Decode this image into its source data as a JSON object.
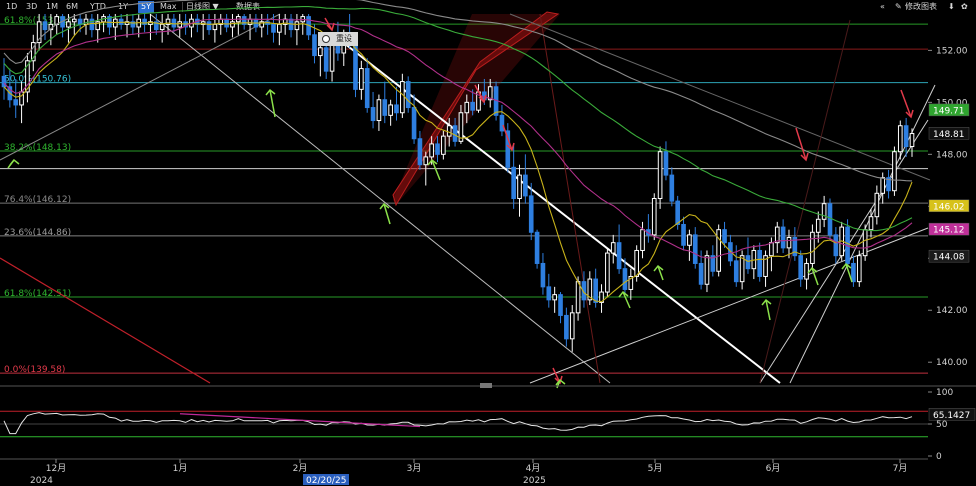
{
  "toolbar": {
    "ranges": [
      "1D",
      "3D",
      "1M",
      "6M",
      "YTD",
      "1Y",
      "5Y",
      "Max"
    ],
    "active_range": "5Y",
    "chart_type_label": "日线图 ▼",
    "table_label": "数据表",
    "edit_chart_label": "修改图表",
    "reset_label": "重设"
  },
  "colors": {
    "candle_up": "#ffffff",
    "candle_down": "#2e7fe0",
    "ma_yellow": "#c8b21a",
    "ma_green": "#3aaa3a",
    "ma_magenta": "#b0308a",
    "ma_gray": "#8a8a8a",
    "trend_white": "#ffffff",
    "fib_green": "#2fb52f",
    "fib_cyan": "#35c1d6",
    "red_arrow": "#e23a4a",
    "green_arrow": "#8be04a",
    "rsi_line": "#e6e6e6",
    "rsi_mag": "#c02a9a"
  },
  "chart_data": {
    "type": "candlestick",
    "y_range": [
      139.2,
      153.4
    ],
    "y_ticks": [
      140,
      142,
      144,
      146,
      148,
      150,
      152
    ],
    "y_tick_labels": [
      "140.00",
      "142.00",
      "144.00",
      "146.00",
      "148.00",
      "150.00",
      "152.00"
    ],
    "fib_levels": [
      {
        "label": "61.8%(153.01)",
        "value": 153.01
      },
      {
        "label": "50.0%(150.76)",
        "value": 150.76
      },
      {
        "label": "38.2%(148.13)",
        "value": 148.13
      },
      {
        "label": "76.4%(146.12)",
        "value": 146.12
      },
      {
        "label": "23.6%(144.86)",
        "value": 144.86
      },
      {
        "label": "61.8%(142.51)",
        "value": 142.51
      },
      {
        "label": "0.0%(139.58)",
        "value": 139.58
      }
    ],
    "price_labels": [
      {
        "text": "149.71",
        "value": 149.71,
        "bg": "#2fa52f"
      },
      {
        "text": "148.81",
        "value": 148.81,
        "bg": "#101010"
      },
      {
        "text": "146.02",
        "value": 146.02,
        "bg": "#d7c21a"
      },
      {
        "text": "145.12",
        "value": 145.12,
        "bg": "#c0309a"
      },
      {
        "text": "144.08",
        "value": 144.08,
        "bg": "#1a1a1a"
      }
    ],
    "x_labels": [
      {
        "text": "12月",
        "sub": "2024"
      },
      {
        "text": "1月",
        "sub": ""
      },
      {
        "text": "2月",
        "sub": ""
      },
      {
        "text": "3月",
        "sub": ""
      },
      {
        "text": "4月",
        "sub": "2025"
      },
      {
        "text": "5月",
        "sub": ""
      },
      {
        "text": "6月",
        "sub": ""
      },
      {
        "text": "7月",
        "sub": ""
      }
    ],
    "cursor_date": "02/20/25",
    "candles": [
      [
        151.0,
        151.7,
        150.1,
        150.6
      ],
      [
        150.6,
        151.3,
        149.8,
        150.1
      ],
      [
        150.1,
        150.9,
        149.4,
        149.9
      ],
      [
        149.9,
        150.8,
        149.2,
        150.4
      ],
      [
        150.4,
        151.9,
        150.0,
        151.6
      ],
      [
        151.6,
        152.6,
        151.2,
        152.3
      ],
      [
        152.3,
        153.4,
        152.0,
        153.1
      ],
      [
        153.1,
        153.4,
        152.4,
        152.8
      ],
      [
        152.8,
        153.4,
        152.2,
        153.0
      ],
      [
        153.0,
        153.4,
        152.6,
        153.3
      ],
      [
        153.3,
        153.4,
        152.5,
        152.9
      ],
      [
        152.9,
        153.4,
        152.3,
        153.1
      ],
      [
        153.1,
        153.4,
        152.6,
        153.2
      ],
      [
        153.2,
        153.4,
        152.7,
        153.0
      ],
      [
        153.0,
        153.4,
        152.6,
        153.2
      ],
      [
        153.2,
        153.4,
        152.5,
        152.8
      ],
      [
        152.8,
        153.4,
        152.3,
        153.1
      ],
      [
        153.1,
        153.4,
        152.7,
        153.3
      ],
      [
        153.3,
        153.4,
        152.6,
        152.9
      ],
      [
        152.9,
        153.4,
        152.4,
        153.2
      ],
      [
        153.2,
        153.4,
        152.8,
        153.0
      ],
      [
        153.0,
        153.4,
        152.5,
        153.1
      ],
      [
        153.1,
        153.4,
        152.6,
        152.9
      ],
      [
        152.9,
        153.4,
        152.5,
        153.2
      ],
      [
        153.2,
        153.4,
        152.7,
        153.0
      ],
      [
        153.0,
        153.4,
        152.4,
        153.1
      ],
      [
        153.1,
        153.4,
        152.6,
        152.8
      ],
      [
        152.8,
        153.4,
        152.3,
        153.0
      ],
      [
        153.0,
        153.4,
        152.6,
        153.2
      ],
      [
        153.2,
        153.4,
        152.7,
        152.9
      ],
      [
        152.9,
        153.4,
        152.5,
        153.1
      ],
      [
        153.1,
        153.4,
        152.6,
        152.9
      ],
      [
        152.9,
        153.4,
        152.5,
        153.2
      ],
      [
        153.2,
        153.4,
        152.7,
        153.0
      ],
      [
        153.0,
        153.4,
        152.4,
        153.1
      ],
      [
        153.1,
        153.4,
        152.6,
        152.8
      ],
      [
        152.8,
        153.4,
        152.3,
        153.0
      ],
      [
        153.0,
        153.4,
        152.6,
        153.2
      ],
      [
        153.2,
        153.4,
        152.7,
        152.9
      ],
      [
        152.9,
        153.4,
        152.5,
        153.1
      ],
      [
        153.1,
        153.4,
        152.6,
        153.3
      ],
      [
        153.3,
        153.4,
        152.8,
        153.0
      ],
      [
        153.0,
        153.4,
        152.4,
        153.2
      ],
      [
        153.2,
        153.4,
        152.7,
        152.9
      ],
      [
        152.9,
        153.4,
        152.5,
        153.1
      ],
      [
        153.1,
        153.4,
        152.6,
        153.0
      ],
      [
        153.0,
        153.4,
        152.3,
        152.7
      ],
      [
        152.7,
        153.4,
        152.2,
        153.0
      ],
      [
        153.0,
        153.4,
        152.6,
        153.2
      ],
      [
        153.2,
        153.4,
        152.5,
        152.8
      ],
      [
        152.8,
        153.4,
        152.2,
        153.1
      ],
      [
        153.1,
        153.4,
        152.6,
        153.3
      ],
      [
        153.3,
        153.4,
        152.4,
        152.6
      ],
      [
        152.6,
        153.0,
        151.5,
        151.8
      ],
      [
        151.8,
        152.4,
        151.0,
        152.1
      ],
      [
        152.1,
        152.5,
        150.9,
        151.2
      ],
      [
        151.2,
        152.6,
        150.8,
        152.4
      ],
      [
        152.4,
        153.1,
        151.6,
        151.9
      ],
      [
        151.9,
        152.8,
        151.4,
        152.6
      ],
      [
        152.6,
        153.4,
        152.1,
        152.3
      ],
      [
        152.3,
        152.7,
        150.2,
        150.5
      ],
      [
        150.5,
        151.6,
        150.1,
        151.3
      ],
      [
        151.3,
        151.7,
        149.6,
        149.8
      ],
      [
        149.8,
        150.4,
        149.0,
        149.3
      ],
      [
        149.3,
        150.3,
        148.9,
        150.1
      ],
      [
        150.1,
        150.8,
        149.2,
        149.5
      ],
      [
        149.5,
        150.1,
        149.1,
        149.9
      ],
      [
        149.9,
        150.6,
        149.3,
        149.6
      ],
      [
        149.6,
        151.1,
        149.4,
        150.8
      ],
      [
        150.8,
        151.0,
        149.6,
        149.8
      ],
      [
        149.8,
        150.3,
        148.4,
        148.6
      ],
      [
        148.6,
        148.9,
        147.4,
        147.6
      ],
      [
        147.6,
        148.1,
        146.8,
        147.9
      ],
      [
        147.9,
        148.7,
        147.6,
        148.4
      ],
      [
        148.4,
        148.7,
        147.7,
        148.0
      ],
      [
        148.0,
        148.9,
        147.8,
        148.7
      ],
      [
        148.7,
        149.4,
        148.3,
        149.1
      ],
      [
        149.1,
        149.4,
        148.3,
        148.5
      ],
      [
        148.5,
        149.9,
        148.4,
        149.6
      ],
      [
        149.6,
        150.3,
        149.2,
        150.0
      ],
      [
        150.0,
        150.5,
        149.5,
        149.7
      ],
      [
        149.7,
        150.7,
        149.6,
        150.4
      ],
      [
        150.4,
        150.9,
        149.9,
        150.1
      ],
      [
        150.1,
        150.9,
        149.8,
        150.6
      ],
      [
        150.6,
        150.8,
        149.3,
        149.5
      ],
      [
        149.5,
        149.9,
        148.7,
        148.9
      ],
      [
        148.9,
        149.2,
        147.3,
        147.5
      ],
      [
        147.5,
        148.4,
        145.9,
        146.3
      ],
      [
        146.3,
        147.6,
        145.6,
        147.2
      ],
      [
        147.2,
        148.0,
        146.1,
        146.4
      ],
      [
        146.4,
        146.9,
        144.7,
        145.0
      ],
      [
        145.0,
        145.1,
        143.6,
        143.8
      ],
      [
        143.8,
        144.2,
        142.6,
        142.9
      ],
      [
        142.9,
        143.4,
        142.1,
        142.4
      ],
      [
        142.4,
        142.9,
        141.9,
        142.6
      ],
      [
        142.6,
        142.7,
        141.5,
        141.8
      ],
      [
        141.8,
        142.1,
        140.6,
        140.9
      ],
      [
        140.9,
        142.2,
        140.4,
        141.9
      ],
      [
        141.9,
        143.3,
        141.6,
        143.1
      ],
      [
        143.1,
        143.5,
        142.1,
        142.4
      ],
      [
        142.4,
        143.5,
        142.2,
        143.2
      ],
      [
        143.2,
        143.6,
        142.1,
        142.3
      ],
      [
        142.3,
        143.0,
        141.9,
        142.7
      ],
      [
        142.7,
        144.4,
        142.5,
        144.2
      ],
      [
        144.2,
        144.9,
        143.8,
        144.6
      ],
      [
        144.6,
        145.3,
        143.4,
        143.6
      ],
      [
        143.6,
        144.0,
        142.6,
        142.8
      ],
      [
        142.8,
        143.6,
        142.4,
        143.3
      ],
      [
        143.3,
        144.5,
        143.1,
        144.3
      ],
      [
        144.3,
        145.4,
        144.0,
        145.1
      ],
      [
        145.1,
        145.7,
        144.6,
        144.9
      ],
      [
        144.9,
        146.5,
        144.7,
        146.3
      ],
      [
        146.3,
        148.3,
        145.9,
        148.1
      ],
      [
        148.1,
        148.5,
        147.0,
        147.2
      ],
      [
        147.2,
        147.5,
        146.0,
        146.2
      ],
      [
        146.2,
        146.4,
        145.1,
        145.3
      ],
      [
        145.3,
        145.6,
        144.3,
        144.5
      ],
      [
        144.5,
        145.1,
        143.9,
        144.9
      ],
      [
        144.9,
        145.2,
        143.6,
        143.8
      ],
      [
        143.8,
        144.3,
        142.8,
        143.0
      ],
      [
        143.0,
        144.3,
        142.7,
        144.1
      ],
      [
        144.1,
        144.5,
        143.3,
        143.5
      ],
      [
        143.5,
        145.3,
        143.3,
        145.1
      ],
      [
        145.1,
        145.4,
        144.4,
        144.6
      ],
      [
        144.6,
        144.9,
        143.7,
        143.9
      ],
      [
        143.9,
        144.5,
        142.9,
        143.1
      ],
      [
        143.1,
        144.3,
        142.8,
        144.1
      ],
      [
        144.1,
        144.8,
        143.4,
        143.6
      ],
      [
        143.6,
        144.5,
        143.2,
        144.3
      ],
      [
        144.3,
        144.6,
        143.1,
        143.3
      ],
      [
        143.3,
        144.3,
        142.9,
        144.1
      ],
      [
        144.1,
        144.8,
        143.5,
        144.6
      ],
      [
        144.6,
        145.4,
        144.2,
        145.2
      ],
      [
        145.2,
        145.5,
        144.2,
        144.4
      ],
      [
        144.4,
        145.1,
        144.0,
        144.8
      ],
      [
        144.8,
        145.2,
        143.9,
        144.1
      ],
      [
        144.1,
        144.3,
        142.9,
        143.2
      ],
      [
        143.2,
        144.0,
        142.8,
        143.8
      ],
      [
        143.8,
        145.3,
        143.6,
        145.0
      ],
      [
        145.0,
        145.8,
        144.6,
        145.5
      ],
      [
        145.5,
        146.4,
        145.2,
        146.1
      ],
      [
        146.1,
        146.3,
        144.7,
        144.9
      ],
      [
        144.9,
        145.2,
        143.8,
        144.1
      ],
      [
        144.1,
        145.4,
        143.9,
        145.2
      ],
      [
        145.2,
        145.5,
        143.6,
        143.8
      ],
      [
        143.8,
        144.1,
        142.9,
        143.1
      ],
      [
        143.1,
        144.3,
        142.9,
        144.1
      ],
      [
        144.1,
        145.3,
        143.9,
        145.1
      ],
      [
        145.1,
        145.9,
        144.8,
        145.6
      ],
      [
        145.6,
        146.8,
        145.3,
        146.5
      ],
      [
        146.5,
        147.3,
        146.1,
        147.1
      ],
      [
        147.1,
        147.4,
        146.3,
        146.6
      ],
      [
        146.6,
        148.3,
        146.4,
        148.1
      ],
      [
        148.1,
        149.3,
        147.8,
        149.1
      ],
      [
        149.1,
        149.4,
        147.9,
        148.3
      ],
      [
        148.3,
        149.0,
        147.9,
        148.8
      ]
    ],
    "rsi": {
      "range": [
        0,
        100
      ],
      "ticks": [
        0,
        50,
        100
      ],
      "last_label": "65.1427",
      "last_value": 65.14
    }
  }
}
